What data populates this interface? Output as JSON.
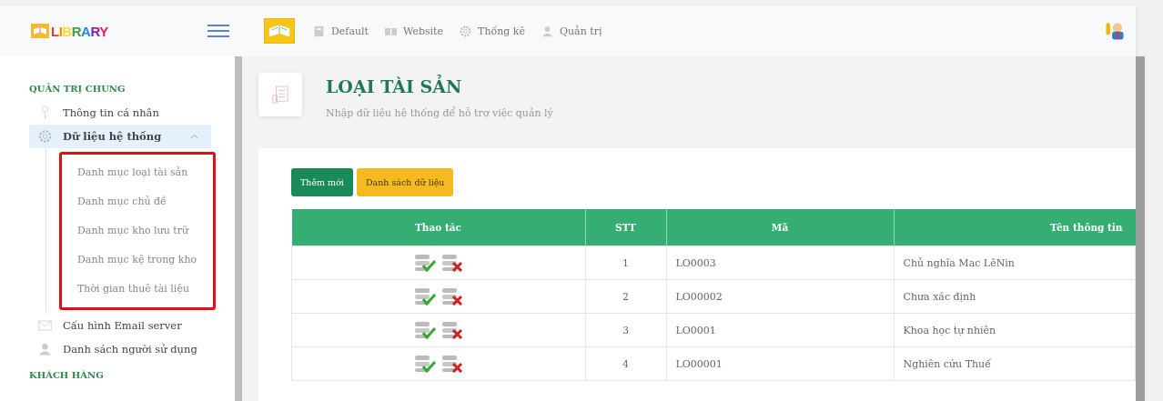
{
  "logo": {
    "text": "LIBRARY"
  },
  "top_nav": [
    {
      "label": "Default",
      "kind": "page"
    },
    {
      "label": "Website",
      "kind": "book"
    },
    {
      "label": "Thống kê",
      "kind": "gear"
    },
    {
      "label": "Quản trị",
      "kind": "user"
    }
  ],
  "sidebar": {
    "sections": [
      {
        "title": "QUẢN TRỊ CHUNG",
        "items": [
          {
            "label": "Thông tin cá nhân",
            "kind": "key",
            "selected": false
          },
          {
            "label": "Dữ liệu hệ thống",
            "kind": "gear",
            "selected": true,
            "expanded": true,
            "highlighted": true,
            "children": [
              {
                "label": "Danh mục loại tài sản"
              },
              {
                "label": "Danh mục chủ đề"
              },
              {
                "label": "Danh mục kho lưu trữ"
              },
              {
                "label": "Danh mục kệ trong kho"
              },
              {
                "label": "Thời gian thuê tài liệu"
              }
            ]
          },
          {
            "label": "Cấu hình Email server",
            "kind": "mail",
            "selected": false
          },
          {
            "label": "Danh sách người sử dụng",
            "kind": "user",
            "selected": false
          }
        ]
      },
      {
        "title": "KHÁCH HÀNG"
      }
    ]
  },
  "page_header": {
    "title": "LOẠI TÀI SẢN",
    "subtitle": "Nhập dữ liệu hệ thống để hỗ trợ việc quản lý"
  },
  "buttons": [
    {
      "label": "Thêm mới",
      "kind": "primary"
    },
    {
      "label": "Danh sách dữ liệu",
      "kind": "warning"
    }
  ],
  "table": {
    "columns": [
      "Thao tác",
      "STT",
      "Mã",
      "Tên thông tin"
    ],
    "rows": [
      {
        "stt": "1",
        "code": "LO0003",
        "name": "Chủ nghĩa Mac LêNin"
      },
      {
        "stt": "2",
        "code": "LO00002",
        "name": "Chưa xác định"
      },
      {
        "stt": "3",
        "code": "LO0001",
        "name": "Khoa học tự nhiên"
      },
      {
        "stt": "4",
        "code": "LO00001",
        "name": "Nghiên cứu Thuế"
      }
    ]
  }
}
